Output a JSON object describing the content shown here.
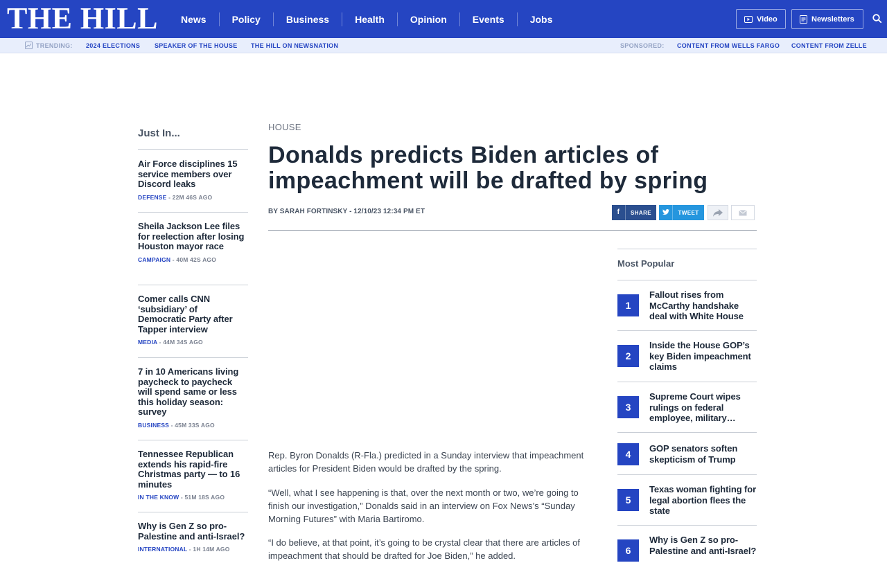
{
  "header": {
    "logo": "THE HILL",
    "nav": [
      "News",
      "Policy",
      "Business",
      "Health",
      "Opinion",
      "Events",
      "Jobs"
    ],
    "video_label": "Video",
    "newsletters_label": "Newsletters",
    "search_icon": "search-icon",
    "brand_color": "#2545c2"
  },
  "trending": {
    "label": "TRENDING:",
    "links": [
      "2024 ELECTIONS",
      "SPEAKER OF THE HOUSE",
      "THE HILL ON NEWSNATION"
    ],
    "sponsored_label": "SPONSORED:",
    "sponsored": [
      "CONTENT FROM WELLS FARGO",
      "CONTENT FROM ZELLE"
    ]
  },
  "just_in": {
    "title": "Just In...",
    "items": [
      {
        "headline": "Air Force disciplines 15 service members over Discord leaks",
        "category": "DEFENSE",
        "time": " - 22M 46S AGO"
      },
      {
        "headline": "Sheila Jackson Lee files for reelection after losing Houston mayor race",
        "category": "CAMPAIGN",
        "time": " - 40M 42S AGO"
      },
      {
        "headline": "Comer calls CNN ‘subsidiary’ of Democratic Party after Tapper interview",
        "category": "MEDIA",
        "time": " - 44M 34S AGO"
      },
      {
        "headline": "7 in 10 Americans living paycheck to paycheck will spend same or less this holiday season: survey",
        "category": "BUSINESS",
        "time": " - 45M 33S AGO"
      },
      {
        "headline": "Tennessee Republican extends his rapid-fire Christmas party — to 16 minutes",
        "category": "IN THE KNOW",
        "time": " - 51M 18S AGO"
      },
      {
        "headline": "Why is Gen Z so pro-Palestine and anti-Israel?",
        "category": "INTERNATIONAL",
        "time": " - 1H 14M AGO"
      }
    ]
  },
  "article": {
    "section": "HOUSE",
    "headline": "Donalds predicts Biden articles of impeachment will be drafted by spring",
    "byline": "BY SARAH FORTINSKY - 12/10/23 12:34 PM ET",
    "share": {
      "facebook": "SHARE",
      "twitter": "TWEET"
    },
    "paragraphs": [
      "Rep. Byron Donalds (R-Fla.) predicted in a Sunday interview that impeachment articles for President Biden would be drafted by the spring.",
      "“Well, what I see happening is that, over the next month or two, we’re going to finish our investigation,” Donalds said in an interview on Fox News’s “Sunday Morning Futures” with Maria Bartiromo.",
      "“I do believe, at that point, it’s going to be crystal clear that there are articles of impeachment that should be drafted for Joe Biden,” he added."
    ]
  },
  "most_popular": {
    "title": "Most Popular",
    "items": [
      {
        "rank": "1",
        "headline": "Fallout rises from McCarthy handshake deal with White House"
      },
      {
        "rank": "2",
        "headline": "Inside the House GOP’s key Biden impeachment claims"
      },
      {
        "rank": "3",
        "headline": "Supreme Court wipes rulings on federal employee, military…"
      },
      {
        "rank": "4",
        "headline": "GOP senators soften skepticism of Trump"
      },
      {
        "rank": "5",
        "headline": "Texas woman fighting for legal abortion flees the state"
      },
      {
        "rank": "6",
        "headline": "Why is Gen Z so pro-Palestine and anti-Israel?"
      }
    ]
  }
}
